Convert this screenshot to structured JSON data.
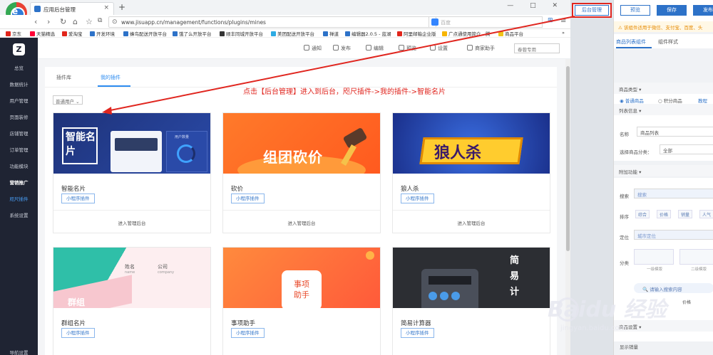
{
  "browser": {
    "tab_title": "应用后台管理",
    "tab_close": "×",
    "new_tab": "+",
    "window_controls": "— □ ✕",
    "url": "www.jisuapp.cn/management/functions/plugins/mines",
    "search_placeholder": "百度",
    "bookmarks": [
      "京东",
      "天猫精选",
      "爱淘宝",
      "开发环境",
      "蜂鸟配送开放平台",
      "饿了么开放平台",
      "顺丰同城开放平台",
      "美团配送开放平台",
      "禅道",
      "编辑器2.0.5 - 蓝湖",
      "阿里邮箱企业版",
      "广点通使用简介 - 腾",
      "商品平台"
    ]
  },
  "app": {
    "logo": "Z",
    "sidebar": [
      "总览",
      "数据统计",
      "用户管理",
      "页面装修",
      "店铺管理",
      "订单管理",
      "功能模块",
      "营销推广",
      "咫尺插件",
      "系统设置",
      "导航设置"
    ],
    "topbar": [
      "通知",
      "发布",
      "编辑",
      "预览",
      "设置",
      "商家助手"
    ],
    "store_select": "春蓉专用",
    "tabs": [
      "插件库",
      "我的插件"
    ],
    "user_select": "普通用户 ⌄",
    "cards": [
      {
        "name": "智能名片",
        "tag": "小程序插件",
        "enter": "进入管理后台",
        "img_text": "智能名片"
      },
      {
        "name": "砍价",
        "tag": "小程序插件",
        "enter": "进入管理后台",
        "img_text": "组团砍价"
      },
      {
        "name": "狼人杀",
        "tag": "小程序插件",
        "enter": "进入管理后台",
        "img_text": "狼人杀"
      },
      {
        "name": "群组名片",
        "tag": "小程序插件",
        "img_text": "群组"
      },
      {
        "name": "事项助手",
        "tag": "小程序插件",
        "img_text": "事项助手"
      },
      {
        "name": "简易计算器",
        "tag": "小程序插件",
        "img_text": "简易计"
      }
    ],
    "card_details": {
      "mingpian_sub": "用户数量",
      "qunzu_name": "姓名",
      "qunzu_company": "公司",
      "qunzu_name_en": "name",
      "qunzu_company_en": "company"
    }
  },
  "annotation": {
    "text": "点击【后台管理】进入到后台，咫尺插件->我的插件->智能名片",
    "admin_button": "后台管理"
  },
  "editor": {
    "buttons": [
      "预览",
      "保存",
      "发布"
    ],
    "notice": "该组件适用于微信、支付宝、百度、头",
    "tabs": [
      "商品列表组件",
      "组件样式"
    ],
    "sections": {
      "type_title": "商品类型 ▾",
      "type_opts": [
        "普通商品",
        "积分商品",
        "教程"
      ],
      "list_title": "列表信息 ▾",
      "name_label": "名称",
      "name_value": "商品列表",
      "cat_label": "选择商品分类：",
      "cat_value": "全部",
      "extra_title": "附加功能 ▾",
      "search_label": "搜索",
      "search_value": "搜索",
      "sort_label": "排序",
      "sort_opts": [
        "综合",
        "价格",
        "销量",
        "人气"
      ],
      "locate_label": "定位",
      "locate_value": "城市定位",
      "cat2_label": "分类",
      "cat2_opts": [
        "一级模版",
        "二级模版"
      ],
      "search_prompt": "请输入搜索内容",
      "price_label": "价格",
      "product_title": "商品设置 ▾",
      "show_sales": "显示销量"
    }
  },
  "watermark": {
    "brand": "Bai",
    "brand2": "经验",
    "url": "jingyan.baidu.com"
  }
}
